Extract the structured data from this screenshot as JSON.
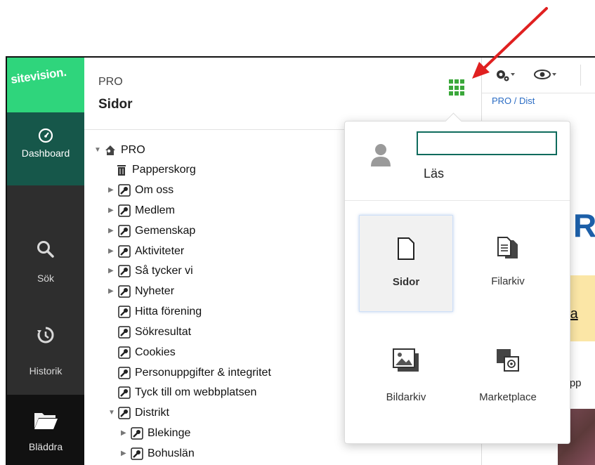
{
  "rail": {
    "logo": "sitevision.",
    "items": [
      {
        "label": "Dashboard",
        "icon": "dashboard-icon"
      },
      {
        "label": "Sök",
        "icon": "search-icon"
      },
      {
        "label": "Historik",
        "icon": "history-icon"
      },
      {
        "label": "Bläddra",
        "icon": "folder-icon"
      }
    ]
  },
  "panel": {
    "pretitle": "PRO",
    "title": "Sidor",
    "apps_icon": "grid-icon"
  },
  "tree": [
    {
      "label": "PRO",
      "level": 0,
      "expanded": true,
      "icon": "home-key-icon"
    },
    {
      "label": "Papperskorg",
      "level": 1,
      "icon": "trash-icon"
    },
    {
      "label": "Om oss",
      "level": 1,
      "collapsed": true,
      "icon": "page-key-icon"
    },
    {
      "label": "Medlem",
      "level": 1,
      "collapsed": true,
      "icon": "page-key-icon"
    },
    {
      "label": "Gemenskap",
      "level": 1,
      "collapsed": true,
      "icon": "page-key-icon"
    },
    {
      "label": "Aktiviteter",
      "level": 1,
      "collapsed": true,
      "icon": "page-key-icon"
    },
    {
      "label": "Så tycker vi",
      "level": 1,
      "collapsed": true,
      "icon": "page-key-icon"
    },
    {
      "label": "Nyheter",
      "level": 1,
      "collapsed": true,
      "icon": "page-key-icon"
    },
    {
      "label": "Hitta förening",
      "level": 1,
      "icon": "page-key-icon"
    },
    {
      "label": "Sökresultat",
      "level": 1,
      "icon": "page-key-icon"
    },
    {
      "label": "Cookies",
      "level": 1,
      "icon": "page-key-icon"
    },
    {
      "label": "Personuppgifter & integritet",
      "level": 1,
      "icon": "page-key-icon"
    },
    {
      "label": "Tyck till om webbplatsen",
      "level": 1,
      "icon": "page-key-icon"
    },
    {
      "label": "Distrikt",
      "level": 1,
      "expanded": true,
      "icon": "page-key-icon"
    },
    {
      "label": "Blekinge",
      "level": 2,
      "collapsed": true,
      "icon": "page-key-icon"
    },
    {
      "label": "Bohuslän",
      "level": 2,
      "collapsed": true,
      "icon": "page-key-icon"
    }
  ],
  "right": {
    "breadcrumb": "PRO / Dist",
    "banner_letter": "R",
    "link_fragment": "ala",
    "text_fragment": "Upp",
    "toolbar_icons": [
      "gear-icon",
      "eye-icon"
    ]
  },
  "popup": {
    "user_name": "",
    "role": "Läs",
    "tiles": [
      {
        "label": "Sidor",
        "icon": "page-icon",
        "selected": true
      },
      {
        "label": "Filarkiv",
        "icon": "file-archive-icon"
      },
      {
        "label": "Bildarkiv",
        "icon": "image-archive-icon"
      },
      {
        "label": "Marketplace",
        "icon": "marketplace-icon"
      }
    ]
  },
  "colors": {
    "rail_bg": "#2e2e2e",
    "logo_green": "#2fd57c",
    "active_teal": "#16574a",
    "grid_green": "#3ba83b",
    "annotation_red": "#e02020"
  }
}
